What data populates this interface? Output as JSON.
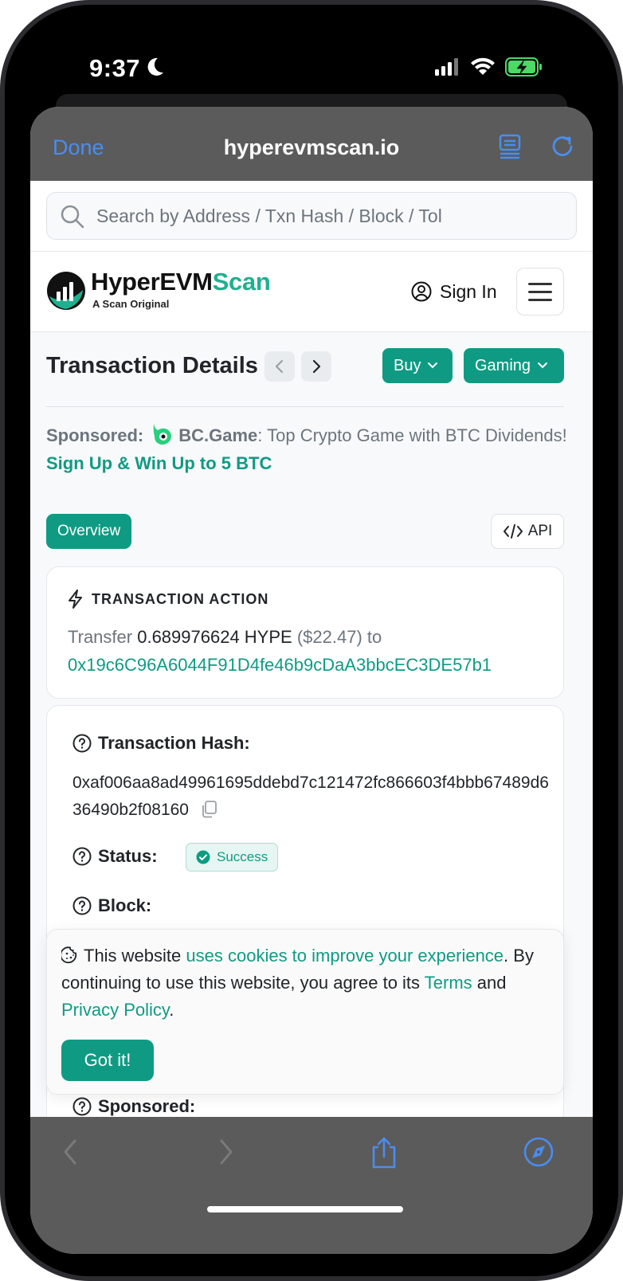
{
  "status_bar": {
    "time": "9:37"
  },
  "browser": {
    "done_label": "Done",
    "domain": "hyperevmscan.io"
  },
  "search": {
    "placeholder": "Search by Address / Txn Hash / Block / Tol"
  },
  "header": {
    "logo_main": "HyperEVM",
    "logo_accent": "Scan",
    "logo_sub": "A Scan Original",
    "signin_label": "Sign In"
  },
  "page": {
    "title": "Transaction Details",
    "buy_label": "Buy",
    "gaming_label": "Gaming"
  },
  "sponsored": {
    "label": "Sponsored:",
    "brand": "BC.Game",
    "text": ": Top Crypto Game with BTC Dividends! ",
    "cta": "Sign Up & Win Up to 5 BTC"
  },
  "tabs": {
    "overview": "Overview",
    "api": "API"
  },
  "transaction_action": {
    "title": "TRANSACTION ACTION",
    "verb": "Transfer",
    "amount": "0.689976624 HYPE",
    "usd": "($22.47) to",
    "address": "0x19c6C96A6044F91D4fe46b9cDaA3bbcEC3DE57b1"
  },
  "details": {
    "hash_label": "Transaction Hash:",
    "hash_value": "0xaf006aa8ad49961695ddebd7c121472fc866603f4bbb67489d636490b2f08160",
    "status_label": "Status:",
    "status_value": "Success",
    "block_label": "Block:",
    "sponsored_label": "Sponsored:"
  },
  "cookie": {
    "t1": "This website ",
    "l1": "uses cookies to improve your experience",
    "t2": ". By continuing to use this website, you agree to its ",
    "l2": "Terms",
    "t3": " and ",
    "l3": "Privacy Policy",
    "t4": ".",
    "button": "Got it!"
  },
  "colors": {
    "accent": "#0f9b83",
    "safari_link": "#4a8df0",
    "toolbar": "#5b5b5b"
  }
}
